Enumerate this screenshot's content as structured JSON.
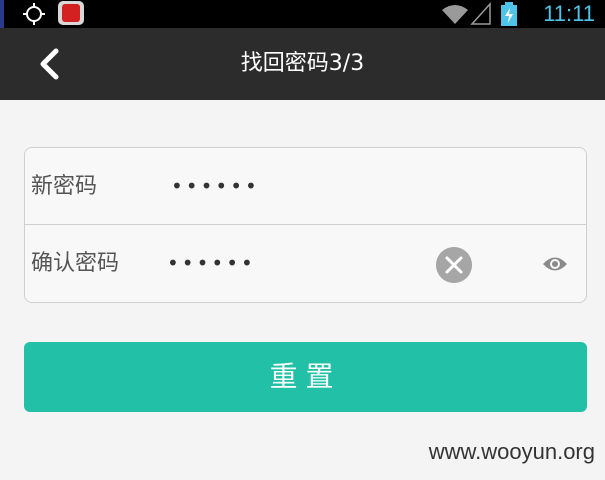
{
  "status_bar": {
    "time": "11:11",
    "icons": [
      "gps-icon",
      "app-icon",
      "wifi-icon",
      "signal-icon",
      "battery-charging-icon"
    ]
  },
  "header": {
    "title": "找回密码3/3",
    "back_icon": "chevron-left-icon"
  },
  "form": {
    "new_password": {
      "label": "新密码",
      "value": "••••••"
    },
    "confirm_password": {
      "label": "确认密码",
      "value": "••••••",
      "clear_icon": "clear-icon",
      "visibility_icon": "eye-icon"
    }
  },
  "reset_button": {
    "label": "重置"
  },
  "watermark": "www.wooyun.org",
  "colors": {
    "header_bg": "#2c2c2c",
    "accent": "#22c0a6",
    "status_text": "#4fc3e8"
  }
}
